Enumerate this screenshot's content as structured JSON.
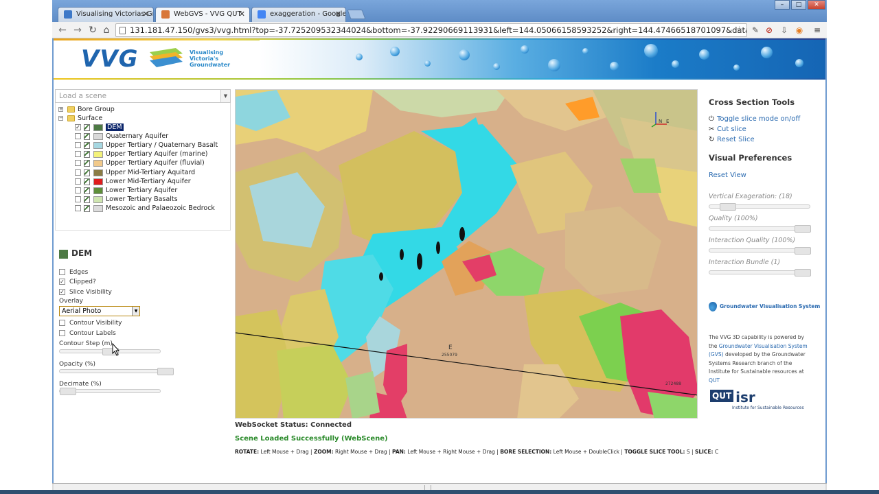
{
  "browser": {
    "tabs": [
      {
        "label": "Visualising Victorias Grou",
        "favicon_color": "#3c78c8",
        "active": false
      },
      {
        "label": "WebGVS - VVG QUT",
        "favicon_color": "#d8773a",
        "active": true
      },
      {
        "label": "exaggeration - Google Sea",
        "favicon_color": "#4285f4",
        "active": false
      }
    ],
    "url": "131.181.47.150/gvs3/vvg.html?top=-37.725209532344024&bottom=-37.92290669113931&left=144.05066158593252&right=144.47466518701097&database=dse_gm"
  },
  "header": {
    "logo_text": "VVG",
    "tagline_lines": [
      "Visualising",
      "Victoria's",
      "Groundwater"
    ]
  },
  "scene": {
    "placeholder": "Load a scene"
  },
  "tree": {
    "groups": [
      {
        "label": "Bore Group",
        "expander": "+"
      },
      {
        "label": "Surface",
        "expander": "−"
      }
    ],
    "layers": [
      {
        "label": "DEM",
        "color": "#4d7a44",
        "checked": true,
        "selected": true
      },
      {
        "label": "Quaternary Aquifer",
        "color": "#d9d9d9",
        "checked": false
      },
      {
        "label": "Upper Tertiary / Quaternary Basalt",
        "color": "#a6d7e1",
        "checked": false
      },
      {
        "label": "Upper Tertiary Aquifer (marine)",
        "color": "#f3f27a",
        "checked": false
      },
      {
        "label": "Upper Tertiary Aquifer (fluvial)",
        "color": "#f1c98a",
        "checked": false
      },
      {
        "label": "Upper Mid-Tertiary Aquitard",
        "color": "#8a7c45",
        "checked": false
      },
      {
        "label": "Lower Mid-Tertiary Aquifer",
        "color": "#e01d1d",
        "checked": false
      },
      {
        "label": "Lower Tertiary Aquifer",
        "color": "#5e8f3a",
        "checked": false
      },
      {
        "label": "Lower Tertiary Basalts",
        "color": "#cfe6b0",
        "checked": false
      },
      {
        "label": "Mesozoic and Palaeozoic Bedrock",
        "color": "#dcdcdc",
        "checked": false
      }
    ]
  },
  "props": {
    "title": "DEM",
    "edges_label": "Edges",
    "clipped_label": "Clipped?",
    "slice_vis_label": "Slice Visibility",
    "overlay_label": "Overlay",
    "overlay_value": "Aerial Photo",
    "contour_vis_label": "Contour Visibility",
    "contour_labels_label": "Contour Labels",
    "contour_step_label": "Contour Step (m)",
    "opacity_label": "Opacity (%)",
    "decimate_label": "Decimate (%)",
    "edges": false,
    "clipped": true,
    "slice_visibility": true,
    "contour_visibility": false,
    "contour_labels": false,
    "contour_step_fraction": 0.5,
    "opacity_fraction": 1.0,
    "decimate_fraction": 0.0
  },
  "viewport": {
    "axis_n": "N",
    "axis_e": "E",
    "section_label_top": "E",
    "section_value_mid": "255079",
    "section_value_right": "272488"
  },
  "status": {
    "websocket": "WebSocket Status: Connected",
    "scene_loaded": "Scene Loaded Successfully (WebScene)",
    "controls": [
      {
        "key": "ROTATE:",
        "value": " Left Mouse + Drag | "
      },
      {
        "key": "ZOOM:",
        "value": " Right Mouse + Drag | "
      },
      {
        "key": "PAN:",
        "value": " Left Mouse + Right Mouse + Drag | "
      },
      {
        "key": "BORE SELECTION:",
        "value": " Left Mouse + DoubleClick | "
      },
      {
        "key": "TOGGLE SLICE TOOL:",
        "value": " S | "
      },
      {
        "key": "SLICE:",
        "value": " C"
      }
    ]
  },
  "right": {
    "cross_title": "Cross Section Tools",
    "toggle_slice": "Toggle slice mode on/off",
    "cut_slice": "Cut slice",
    "reset_slice": "Reset Slice",
    "visual_title": "Visual Preferences",
    "reset_view": "Reset View",
    "vert_exag": "Vertical Exageration: (18)",
    "quality": "Quality (100%)",
    "interaction_quality": "Interaction Quality (100%)",
    "interaction_bundle": "Interaction Bundle (1)",
    "vert_exag_fraction": 0.12,
    "quality_fraction": 1.0,
    "interaction_quality_fraction": 1.0,
    "interaction_bundle_fraction": 1.0,
    "gvs_name": "Groundwater Visualisation System",
    "about_1": "The VVG 3D capability is powered by the",
    "about_link": "Groundwater Visualisation System (GVS)",
    "about_2": "developed by the Groundwater Systems Research branch of the Institute for Sustainable resources at",
    "about_qut": "QUT",
    "isr_qut": "QUT",
    "isr_text": "isr",
    "isr_sub": "Institute for Sustainable Resources"
  }
}
